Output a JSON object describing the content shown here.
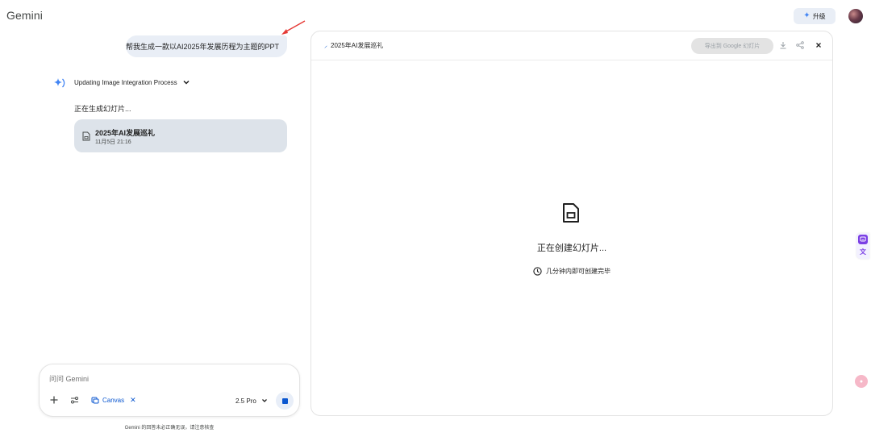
{
  "app": {
    "title": "Gemini",
    "upgrade_label": "升级",
    "accent_color": "#0b57d0"
  },
  "chat": {
    "user_message": "帮我生成一款以AI2025年发展历程为主题的PPT",
    "thinking_label": "Updating Image Integration Process",
    "status_text": "正在生成幻灯片...",
    "doc_card": {
      "title": "2025年AI发展巡礼",
      "timestamp": "11月5日 21:16",
      "icon": "document-icon"
    }
  },
  "input": {
    "placeholder": "问问 Gemini",
    "canvas_chip_label": "Canvas",
    "model_label": "2.5 Pro",
    "disclaimer": "Gemini 的回答未必正确无误，请注意核查"
  },
  "canvas_panel": {
    "title": "2025年AI发展巡礼",
    "export_label": "导出到 Google 幻灯片",
    "creating_text": "正在创建幻灯片...",
    "eta_text": "几分钟内即可创建完毕"
  },
  "side_widget": {
    "bottom_label": "文"
  }
}
